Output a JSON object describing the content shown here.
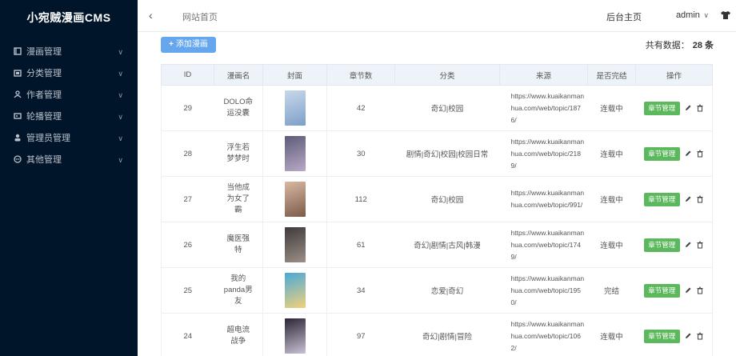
{
  "sidebar": {
    "brand": "小宛贼漫画CMS",
    "items": [
      {
        "label": "漫画管理",
        "icon": "book-icon"
      },
      {
        "label": "分类管理",
        "icon": "folder-icon"
      },
      {
        "label": "作者管理",
        "icon": "user-icon"
      },
      {
        "label": "轮播管理",
        "icon": "carousel-icon"
      },
      {
        "label": "管理员管理",
        "icon": "admin-icon"
      },
      {
        "label": "其他管理",
        "icon": "chat-icon"
      }
    ]
  },
  "topbar": {
    "breadcrumb": "网站首页",
    "home_link": "后台主页",
    "user": "admin"
  },
  "toolbar": {
    "add_label": "添加漫画",
    "total_label": "共有数据：",
    "total_count": "28 条"
  },
  "table": {
    "columns": [
      "ID",
      "漫画名",
      "封面",
      "章节数",
      "分类",
      "来源",
      "是否完结",
      "操作"
    ],
    "rows": [
      {
        "id": "29",
        "name": "DOLO命运没囊",
        "chapters": "42",
        "category": "奇幻|校园",
        "source": "https://www.kuaikanmanhua.com/web/topic/1876/",
        "status": "连载中",
        "cover_colors": [
          "#c9d8ea",
          "#7d9fc9"
        ]
      },
      {
        "id": "28",
        "name": "浮生若梦梦时",
        "chapters": "30",
        "category": "剧情|奇幻|校园|校园日常",
        "source": "https://www.kuaikanmanhua.com/web/topic/2189/",
        "status": "连载中",
        "cover_colors": [
          "#5c5c78",
          "#b9a9c6"
        ]
      },
      {
        "id": "27",
        "name": "当他成为女了霸",
        "chapters": "112",
        "category": "奇幻|校园",
        "source": "https://www.kuaikanmanhua.com/web/topic/991/",
        "status": "连载中",
        "cover_colors": [
          "#d9b9a4",
          "#7a5b47"
        ]
      },
      {
        "id": "26",
        "name": "魔医强特",
        "chapters": "61",
        "category": "奇幻|剧情|古风|韩漫",
        "source": "https://www.kuaikanmanhua.com/web/topic/1749/",
        "status": "连载中",
        "cover_colors": [
          "#3f3a3c",
          "#9c8f86"
        ]
      },
      {
        "id": "25",
        "name": "我的panda男友",
        "chapters": "34",
        "category": "恋爱|奇幻",
        "source": "https://www.kuaikanmanhua.com/web/topic/1950/",
        "status": "完结",
        "cover_colors": [
          "#4aa9d9",
          "#f2d17a"
        ]
      },
      {
        "id": "24",
        "name": "超电流战争",
        "chapters": "97",
        "category": "奇幻|剧情|冒险",
        "source": "https://www.kuaikanmanhua.com/web/topic/1062/",
        "status": "连载中",
        "cover_colors": [
          "#2c2536",
          "#c9c2d6"
        ]
      }
    ],
    "chapter_btn": "章节管理"
  }
}
